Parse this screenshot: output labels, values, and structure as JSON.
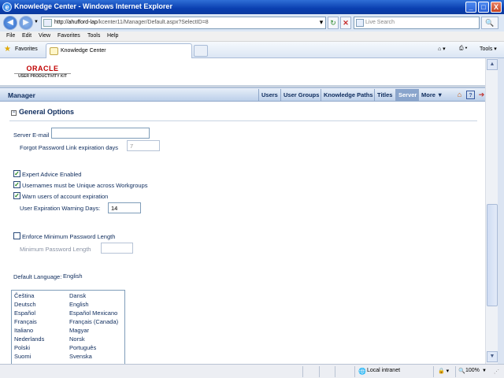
{
  "window": {
    "title": "Knowledge Center - Windows Internet Explorer",
    "minimize": "_",
    "maximize": "□",
    "close": "X"
  },
  "address": {
    "url_host": "http://ahufford-lap",
    "url_path": "/kcenter11/Manager/Default.aspx?SelectID=8",
    "search_placeholder": "Live Search"
  },
  "menu": [
    "File",
    "Edit",
    "View",
    "Favorites",
    "Tools",
    "Help"
  ],
  "favorites": {
    "label": "Favorites",
    "tab_title": "Knowledge Center",
    "tools_label": "Tools"
  },
  "app": {
    "logo_brand": "ORACLE",
    "logo_sub": "USER PRODUCTIVITY KIT",
    "manager_label": "Manager",
    "nav": [
      "Users",
      "User Groups",
      "Knowledge Paths",
      "Titles",
      "Server",
      "More ▼"
    ],
    "active_nav": "Server"
  },
  "section": {
    "title": "General Options",
    "server_email_label": "Server E-mail",
    "server_email_value": "",
    "forgot_pw_label": "Forgot Password Link expiration days",
    "forgot_pw_value": "7",
    "expert_advice_label": "Expert Advice Enabled",
    "expert_advice_checked": true,
    "unique_usernames_label": "Usernames must be Unique across Workgroups",
    "unique_usernames_checked": true,
    "warn_expiration_label": "Warn users of account expiration",
    "warn_expiration_checked": true,
    "warning_days_label": "User Expiration Warning Days:",
    "warning_days_value": "14",
    "enforce_min_pw_label": "Enforce Minimum Password Length",
    "enforce_min_pw_checked": false,
    "min_pw_label": "Minimum Password Length",
    "min_pw_value": "",
    "default_language_label": "Default Language:",
    "default_language_value": "English"
  },
  "languages": [
    [
      "Čeština",
      "Dansk"
    ],
    [
      "Deutsch",
      "English"
    ],
    [
      "Español",
      "Español Mexicano"
    ],
    [
      "Français",
      "Français (Canada)"
    ],
    [
      "Italiano",
      "Magyar"
    ],
    [
      "Nederlands",
      "Norsk"
    ],
    [
      "Polski",
      "Português"
    ],
    [
      "Suomi",
      "Svenska"
    ]
  ],
  "status": {
    "zone": "Local intranet",
    "zoom": "100%"
  }
}
